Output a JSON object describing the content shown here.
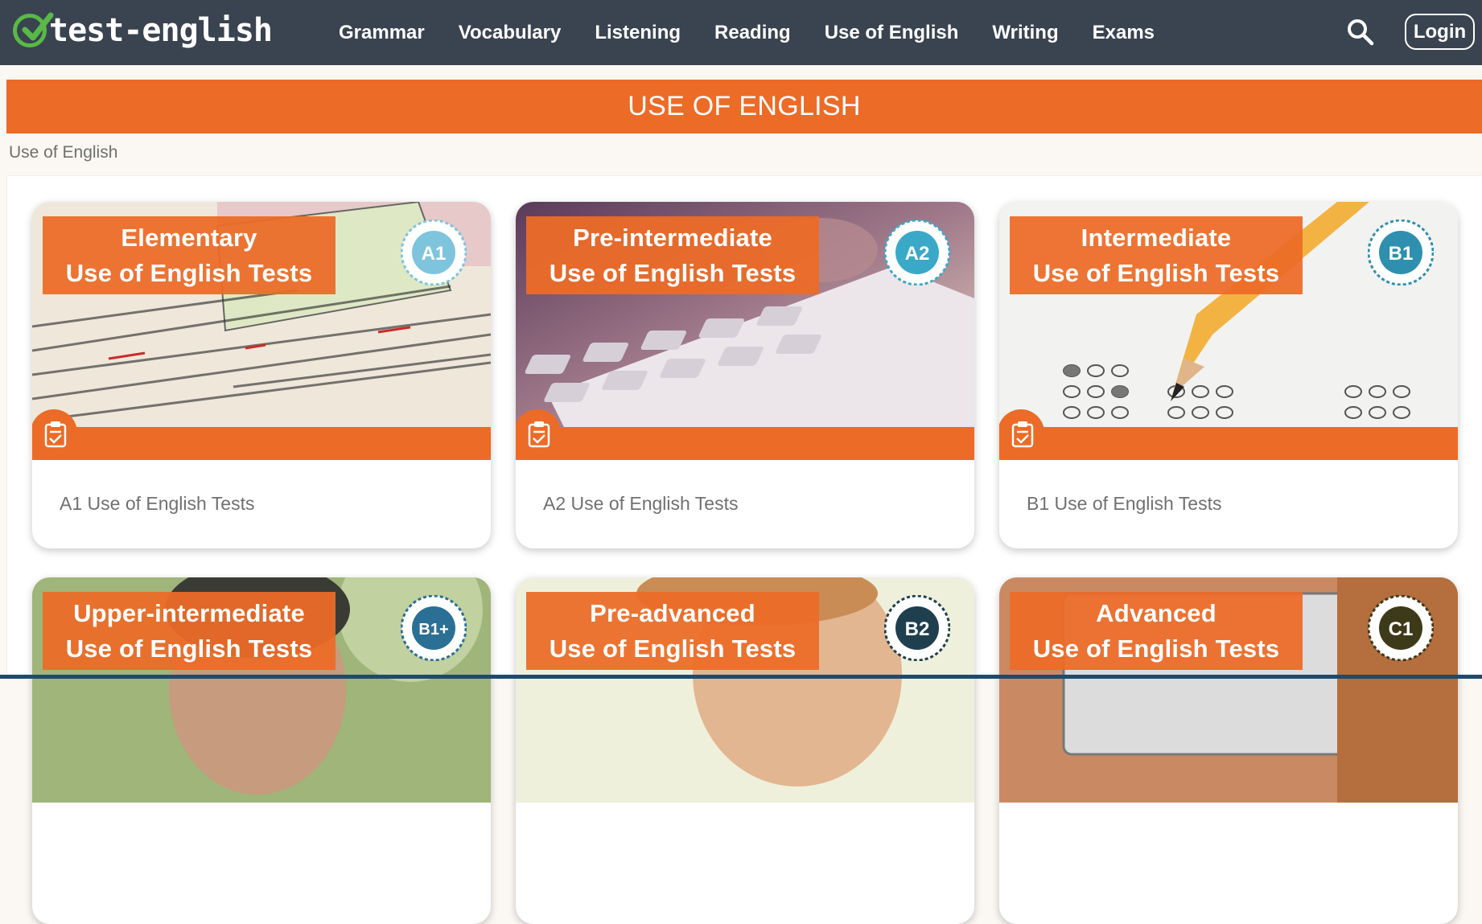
{
  "header": {
    "logo_text": "test-english",
    "nav": [
      "Grammar",
      "Vocabulary",
      "Listening",
      "Reading",
      "Use of English",
      "Writing",
      "Exams"
    ],
    "login_label": "Login",
    "colors": {
      "bar": "#3a4350",
      "logo_check": "#58b947"
    }
  },
  "page": {
    "title": "USE OF ENGLISH",
    "breadcrumb": "Use of English",
    "accent": "#ec6b27"
  },
  "cards": [
    {
      "banner_line1": "Elementary",
      "banner_line2": "Use of English Tests",
      "badge": "A1",
      "badge_color": "#7fc4dd",
      "label": "A1 Use of English Tests"
    },
    {
      "banner_line1": "Pre-intermediate",
      "banner_line2": "Use of English Tests",
      "badge": "A2",
      "badge_color": "#3aa9c7",
      "label": "A2 Use of English Tests"
    },
    {
      "banner_line1": "Intermediate",
      "banner_line2": "Use of English Tests",
      "badge": "B1",
      "badge_color": "#2f8fae",
      "label": "B1 Use of English Tests"
    },
    {
      "banner_line1": "Upper-intermediate",
      "banner_line2": "Use of English Tests",
      "badge": "B1+",
      "badge_color": "#2b6f95",
      "label": ""
    },
    {
      "banner_line1": "Pre-advanced",
      "banner_line2": "Use of English Tests",
      "badge": "B2",
      "badge_color": "#1f3f4f",
      "label": ""
    },
    {
      "banner_line1": "Advanced",
      "banner_line2": "Use of English Tests",
      "badge": "C1",
      "badge_color": "#3d3a1a",
      "label": ""
    }
  ]
}
